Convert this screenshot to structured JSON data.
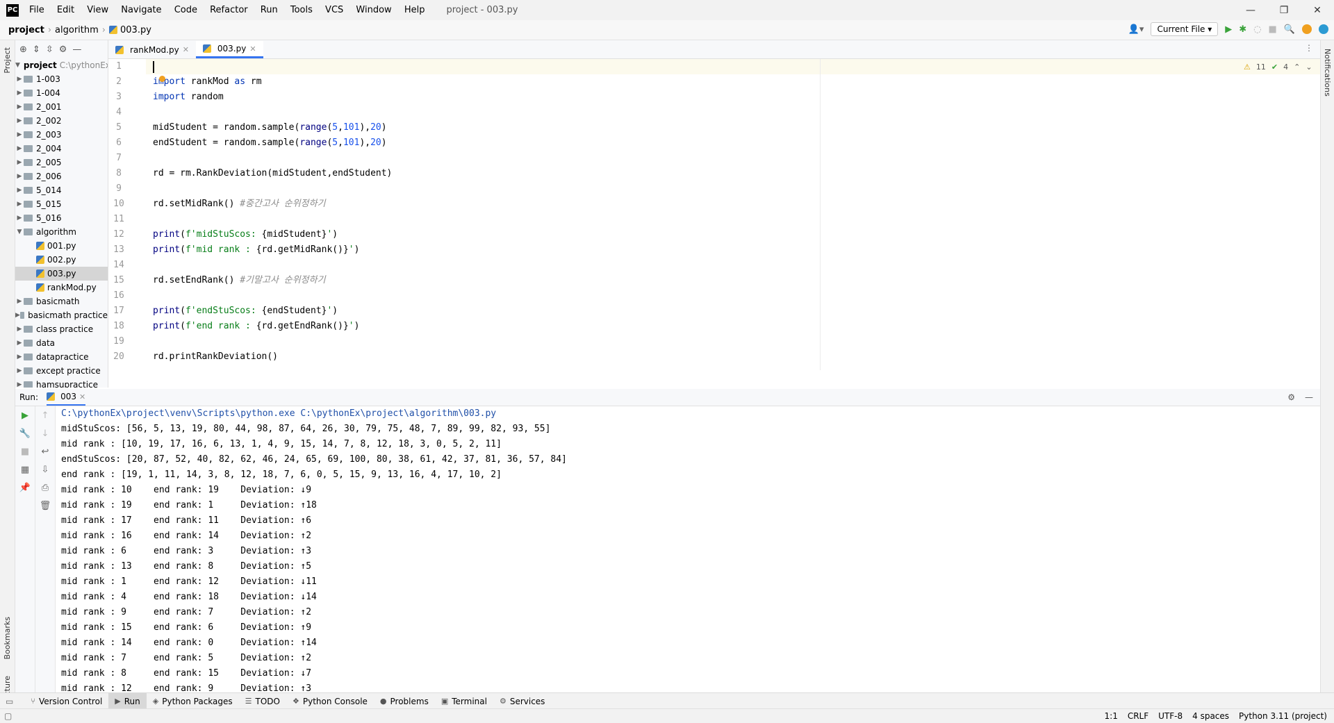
{
  "titlebar": {
    "logo": "PC",
    "menu": [
      "File",
      "Edit",
      "View",
      "Navigate",
      "Code",
      "Refactor",
      "Run",
      "Tools",
      "VCS",
      "Window",
      "Help"
    ],
    "window_title": "project - 003.py"
  },
  "navbar": {
    "breadcrumbs": [
      "project",
      "algorithm",
      "003.py"
    ],
    "run_config": "Current File"
  },
  "left_strip": {
    "top": "Project",
    "bottom1": "Bookmarks",
    "bottom2": "Structure"
  },
  "right_strip": {
    "label": "Notifications"
  },
  "project": {
    "root_name": "project",
    "root_path": "C:\\pythonEx",
    "items": [
      {
        "label": "1-003",
        "type": "folder"
      },
      {
        "label": "1-004",
        "type": "folder"
      },
      {
        "label": "2_001",
        "type": "folder"
      },
      {
        "label": "2_002",
        "type": "folder"
      },
      {
        "label": "2_003",
        "type": "folder"
      },
      {
        "label": "2_004",
        "type": "folder"
      },
      {
        "label": "2_005",
        "type": "folder"
      },
      {
        "label": "2_006",
        "type": "folder"
      },
      {
        "label": "5_014",
        "type": "folder"
      },
      {
        "label": "5_015",
        "type": "folder"
      },
      {
        "label": "5_016",
        "type": "folder"
      },
      {
        "label": "algorithm",
        "type": "folder-open"
      },
      {
        "label": "001.py",
        "type": "file"
      },
      {
        "label": "002.py",
        "type": "file"
      },
      {
        "label": "003.py",
        "type": "file",
        "selected": true
      },
      {
        "label": "rankMod.py",
        "type": "file"
      },
      {
        "label": "basicmath",
        "type": "folder"
      },
      {
        "label": "basicmath practice",
        "type": "folder"
      },
      {
        "label": "class practice",
        "type": "folder"
      },
      {
        "label": "data",
        "type": "folder"
      },
      {
        "label": "datapractice",
        "type": "folder"
      },
      {
        "label": "except practice",
        "type": "folder"
      },
      {
        "label": "hamsupractice",
        "type": "folder"
      }
    ]
  },
  "editor": {
    "tabs": [
      {
        "label": "rankMod.py",
        "active": false
      },
      {
        "label": "003.py",
        "active": true
      }
    ],
    "inspections": {
      "warnings": "11",
      "ok": "4"
    },
    "line_numbers": [
      "1",
      "2",
      "3",
      "4",
      "5",
      "6",
      "7",
      "8",
      "9",
      "10",
      "11",
      "12",
      "13",
      "14",
      "15",
      "16",
      "17",
      "18",
      "19",
      "20"
    ]
  },
  "run": {
    "label": "Run:",
    "tab": "003",
    "output": [
      "C:\\pythonEx\\project\\venv\\Scripts\\python.exe C:\\pythonEx\\project\\algorithm\\003.py",
      "midStuScos: [56, 5, 13, 19, 80, 44, 98, 87, 64, 26, 30, 79, 75, 48, 7, 89, 99, 82, 93, 55]",
      "mid rank : [10, 19, 17, 16, 6, 13, 1, 4, 9, 15, 14, 7, 8, 12, 18, 3, 0, 5, 2, 11]",
      "endStuScos: [20, 87, 52, 40, 82, 62, 46, 24, 65, 69, 100, 80, 38, 61, 42, 37, 81, 36, 57, 84]",
      "end rank : [19, 1, 11, 14, 3, 8, 12, 18, 7, 6, 0, 5, 15, 9, 13, 16, 4, 17, 10, 2]",
      "mid rank : 10    end rank: 19    Deviation: ↓9",
      "mid rank : 19    end rank: 1     Deviation: ↑18",
      "mid rank : 17    end rank: 11    Deviation: ↑6",
      "mid rank : 16    end rank: 14    Deviation: ↑2",
      "mid rank : 6     end rank: 3     Deviation: ↑3",
      "mid rank : 13    end rank: 8     Deviation: ↑5",
      "mid rank : 1     end rank: 12    Deviation: ↓11",
      "mid rank : 4     end rank: 18    Deviation: ↓14",
      "mid rank : 9     end rank: 7     Deviation: ↑2",
      "mid rank : 15    end rank: 6     Deviation: ↑9",
      "mid rank : 14    end rank: 0     Deviation: ↑14",
      "mid rank : 7     end rank: 5     Deviation: ↑2",
      "mid rank : 8     end rank: 15    Deviation: ↓7",
      "mid rank : 12    end rank: 9     Deviation: ↑3"
    ]
  },
  "bottom_tools": [
    {
      "label": "Version Control",
      "icon": "branch-icon"
    },
    {
      "label": "Run",
      "icon": "run-icon",
      "active": true
    },
    {
      "label": "Python Packages",
      "icon": "packages-icon"
    },
    {
      "label": "TODO",
      "icon": "todo-icon"
    },
    {
      "label": "Python Console",
      "icon": "console-icon"
    },
    {
      "label": "Problems",
      "icon": "problems-icon"
    },
    {
      "label": "Terminal",
      "icon": "terminal-icon"
    },
    {
      "label": "Services",
      "icon": "services-icon"
    }
  ],
  "status": {
    "position": "1:1",
    "line_sep": "CRLF",
    "encoding": "UTF-8",
    "indent": "4 spaces",
    "interpreter": "Python 3.11 (project)"
  }
}
